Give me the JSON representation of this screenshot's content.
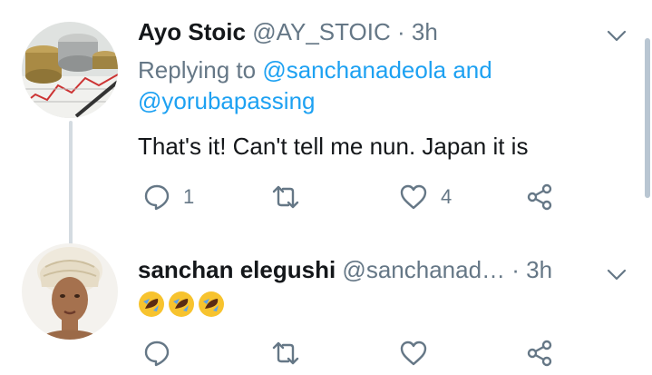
{
  "tweets": [
    {
      "name": "Ayo Stoic",
      "handle": "@AY_STOIC",
      "sep": " · ",
      "time": "3h",
      "replying_prefix": "Replying to ",
      "reply_user_1": "@sanchanadeola",
      "reply_and": " and",
      "reply_user_2": "@yorubapassing",
      "text": "That's it! Can't tell me nun. Japan it is",
      "reply_count": "1",
      "retweet_count": "",
      "like_count": "4"
    },
    {
      "name": "sanchan elegushi",
      "handle": "@sanchanad…",
      "sep": " · ",
      "time": "3h",
      "text_emojis": [
        "rolling-on-floor-laughing",
        "rolling-on-floor-laughing",
        "rolling-on-floor-laughing"
      ],
      "reply_count": "",
      "retweet_count": "",
      "like_count": ""
    }
  ],
  "colors": {
    "link": "#1da1f2",
    "muted": "#657786",
    "text": "#14171a",
    "icon": "#657786",
    "thread": "#d4dbe1"
  }
}
